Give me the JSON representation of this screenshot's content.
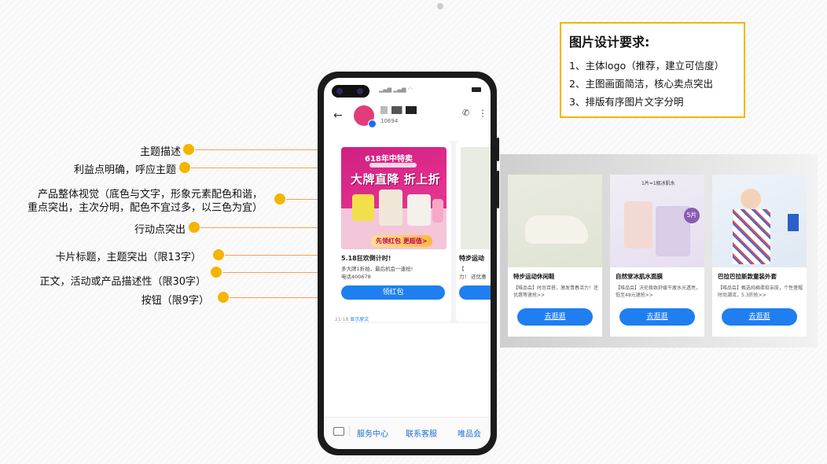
{
  "requirements": {
    "title": "图片设计要求:",
    "items": [
      "1、主体logo（推荐，建立可信度）",
      "2、主图画面简洁，核心卖点突出",
      "3、排版有序图片文字分明"
    ]
  },
  "annotations": [
    {
      "text": "主题描述"
    },
    {
      "text": "利益点明确，呼应主题"
    },
    {
      "text": "产品整体视觉（底色与文字，形象元素配色和谐，"
    },
    {
      "text": "重点突出，主次分明，配色不宜过多，以三色为宜）"
    },
    {
      "text": "行动点突出"
    },
    {
      "text": "卡片标题，主题突出（限13字）"
    },
    {
      "text": "正文，活动或产品描述性（限30字）"
    },
    {
      "text": "按钮（限9字）"
    }
  ],
  "phone": {
    "sender_number": "10694",
    "promo": {
      "tag": "618年中特卖",
      "headline": "大牌直降 折上折",
      "cta": "先领红包 更超值>"
    },
    "card": {
      "title": "5.18狂欢倒计时!",
      "body": "多大牌1折拍，最后机会一速抢!",
      "body2": "电话400678",
      "button": "领红包"
    },
    "card2": {
      "title": "特步运动",
      "body": "【",
      "body2": "力！ 还优惠"
    },
    "msg_time": "21:18",
    "msg_link": "显示原文",
    "menu": [
      "服务中心",
      "联系客服",
      "唯品会"
    ]
  },
  "gallery": [
    {
      "title": "特步运动休闲鞋",
      "body": "【唯品会】时尚百搭，激发青春活力！还优惠等速抢>>",
      "button": "去逛逛"
    },
    {
      "title": "自然堂冰肌水面膜",
      "body": "【唯品会】沃伦极致舒缓干疲水光透亮，低至48元速抢>>",
      "button": "去逛逛",
      "img_label": "1片=1瓶冰肌水",
      "badge": "5片"
    },
    {
      "title": "巴拉巴拉新款童装外套",
      "body": "【唯品会】甄选纯棉柔软亲肤，个性蓬帽时尚潮流，5.3折抢>>",
      "button": "去逛逛"
    }
  ],
  "colors": {
    "accent": "#f5b400",
    "button_blue": "#1f7ff0",
    "promo_pink": "#d01f82"
  }
}
